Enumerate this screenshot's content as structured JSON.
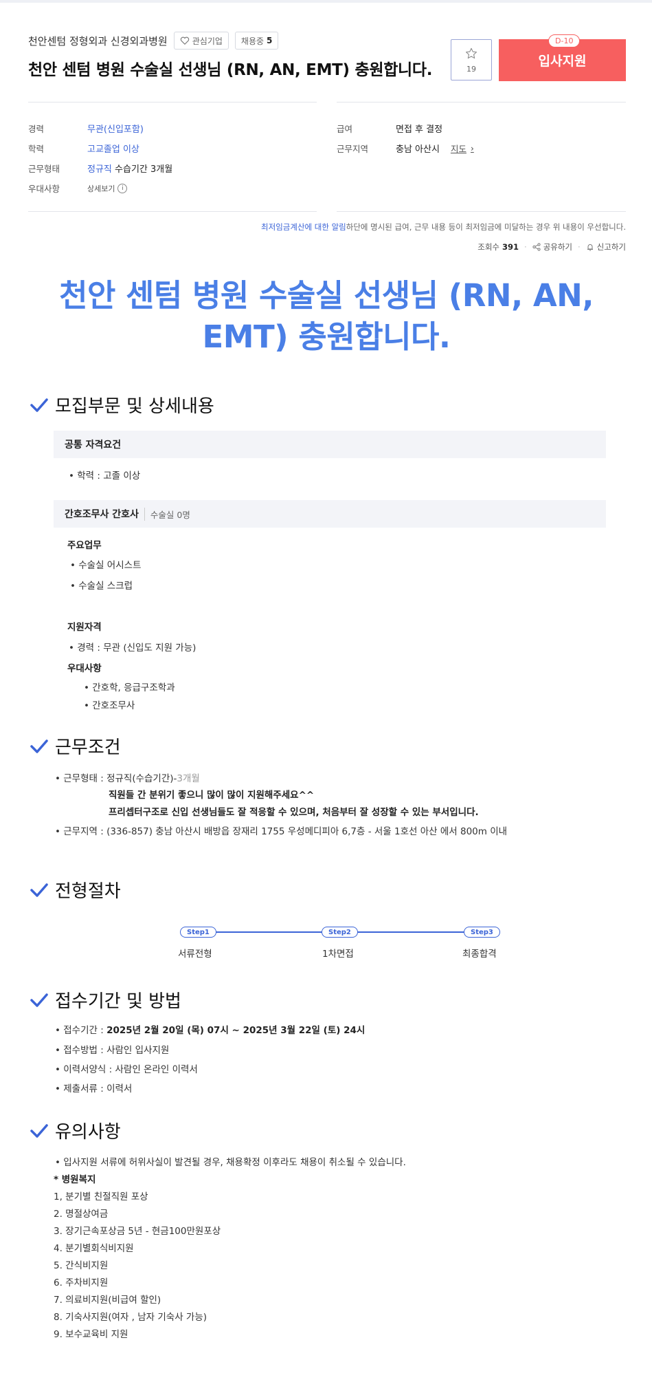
{
  "header": {
    "company_name": "천안센텀 정형외과 신경외과병원",
    "favorite_chip": "관심기업",
    "hiring_label": "채용중",
    "hiring_count": "5",
    "title": "천안 센텀 병원 수술실 선생님 (RN, AN, EMT) 충원합니다.",
    "scrap_count": "19",
    "dday": "D-10",
    "apply_label": "입사지원"
  },
  "summary": {
    "left": [
      {
        "label": "경력",
        "value": "무관(신입포함)"
      },
      {
        "label": "학력",
        "value": "고교졸업 이상"
      },
      {
        "label": "근무형태",
        "value": "정규직",
        "extra": "수습기간 3개월"
      },
      {
        "label": "우대사항",
        "value": "상세보기"
      }
    ],
    "right": [
      {
        "label": "급여",
        "value": "면접 후 결정"
      },
      {
        "label": "근무지역",
        "value": "충남 아산시",
        "link": "지도"
      }
    ]
  },
  "notice": {
    "link": "최저임금계산에 대한 알림",
    "text": "하단에 명시된 급여, 근무 내용 등이 최저임금에 미달하는 경우 위 내용이 우선합니다."
  },
  "meta": {
    "views_label": "조회수",
    "views": "391",
    "share": "공유하기",
    "report": "신고하기"
  },
  "big_title": "천안 센텀 병원 수술실 선생님 (RN, AN, EMT) 충원합니다.",
  "sections": {
    "recruit": {
      "title": "모집부문 및 상세내용",
      "common_head": "공통 자격요건",
      "common_item": "• 학력 : 고졸 이상",
      "role_head": "간호조무사 간호사",
      "role_sub": "수술실 0명",
      "duties_head": "주요업무",
      "duties": [
        "•  수술실 어시스트",
        "•  수술실 스크럽"
      ],
      "qual_head": "지원자격",
      "qual_item": "• 경력 : 무관 (신입도 지원 가능)",
      "pref_head": "우대사항",
      "prefs": [
        "• 간호학, 응급구조학과",
        "• 간호조무사"
      ]
    },
    "conditions": {
      "title": "근무조건",
      "type_prefix": "• 근무형태 : 정규직(수습기간)-",
      "type_muted": "3개월",
      "note1": "직원들 간 분위기 좋으니 많이 많이 지원해주세요^^",
      "note2": "프리셉터구조로 신입 선생님들도 잘 적응할 수 있으며, 처음부터 잘 성장할 수 있는 부서입니다.",
      "location": "• 근무지역 : (336-857) 충남 아산시 배방읍 장재리 1755 우성메디피아 6,7층 - 서울 1호선 아산 에서 800m 이내"
    },
    "process": {
      "title": "전형절차",
      "steps": [
        {
          "badge": "Step1",
          "label": "서류전형"
        },
        {
          "badge": "Step2",
          "label": "1차면접"
        },
        {
          "badge": "Step3",
          "label": "최종합격"
        }
      ]
    },
    "apply": {
      "title": "접수기간 및 방법",
      "period_prefix": "• 접수기간 : ",
      "period": "2025년 2월 20일 (목) 07시 ~ 2025년 3월 22일 (토) 24시",
      "method": "• 접수방법 : 사람인 입사지원",
      "form": "• 이력서양식 : 사람인 온라인 이력서",
      "docs": "• 제출서류 : 이력서"
    },
    "notes": {
      "title": "유의사항",
      "warning": "• 입사지원 서류에 허위사실이 발견될 경우, 채용확정 이후라도 채용이 취소될 수 있습니다.",
      "welfare_head": "* 병원복지",
      "welfare": [
        "1, 분기별 친절직원 포상",
        "2. 명절상여금",
        "3. 장기근속포상금 5년 - 현금100만원포상",
        "4. 분기별회식비지원",
        "5. 간식비지원",
        "6. 주차비지원",
        "7. 의료비지원(비급여 할인)",
        "8. 기숙사지원(여자 , 남자 기숙사 가능)",
        "9. 보수교육비 지원"
      ]
    }
  },
  "colors": {
    "accent": "#3b64d7",
    "apply": "#f75f5f",
    "big_title": "#4a7fe6"
  }
}
